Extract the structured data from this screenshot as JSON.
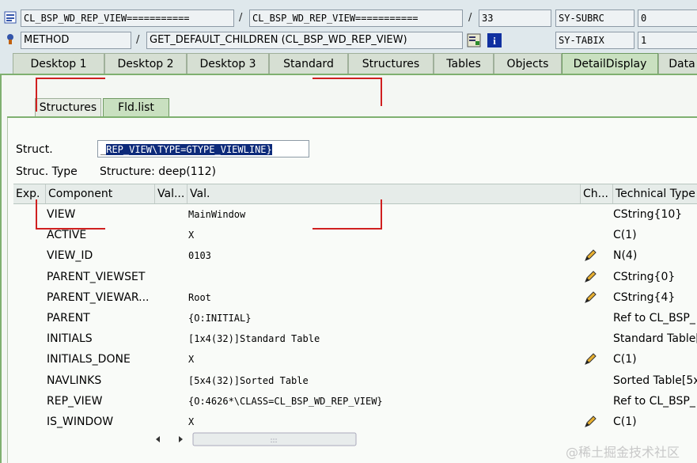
{
  "header": {
    "row1": {
      "field1": "CL_BSP_WD_REP_VIEW===========",
      "field2": "CL_BSP_WD_REP_VIEW===========",
      "line": "33",
      "sysvar_name": "SY-SUBRC",
      "sysvar_value": "0"
    },
    "row2": {
      "field1": "METHOD",
      "field2": "GET_DEFAULT_CHILDREN (CL_BSP_WD_REP_VIEW)",
      "sysvar_name": "SY-TABIX",
      "sysvar_value": "1"
    },
    "ellipsis": "_"
  },
  "tabs": [
    "Desktop 1",
    "Desktop 2",
    "Desktop 3",
    "Standard",
    "Structures",
    "Tables",
    "Objects",
    "DetailDisplay",
    "Data"
  ],
  "active_tab": "DetailDisplay",
  "subtabs": [
    "Structures",
    "Fld.list"
  ],
  "struct": {
    "label": "Struct.",
    "value": "REP_VIEW\\TYPE=GTYPE_VIEWLINE}",
    "value_prefix": "_",
    "type_label": "Struc. Type",
    "type_value": "Structure: deep(112)"
  },
  "table": {
    "headers": [
      "Exp.",
      "Component",
      "Val...",
      "Val.",
      "Ch...",
      "Technical Type"
    ],
    "rows": [
      {
        "component": "VIEW",
        "value": "MainWindow",
        "changeable": false,
        "type": "CString{10}"
      },
      {
        "component": "ACTIVE",
        "value": "X",
        "changeable": false,
        "type": "C(1)"
      },
      {
        "component": "VIEW_ID",
        "value": "0103",
        "changeable": true,
        "type": "N(4)"
      },
      {
        "component": "PARENT_VIEWSET",
        "value": "",
        "changeable": true,
        "type": "CString{0}"
      },
      {
        "component": "PARENT_VIEWAR...",
        "value": "Root",
        "changeable": true,
        "type": "CString{4}"
      },
      {
        "component": "PARENT",
        "value": "{O:INITIAL}",
        "changeable": false,
        "type": "Ref to CL_BSP_"
      },
      {
        "component": "INITIALS",
        "value": "[1x4(32)]Standard Table",
        "changeable": false,
        "type": "Standard Table["
      },
      {
        "component": "INITIALS_DONE",
        "value": "X",
        "changeable": true,
        "type": "C(1)"
      },
      {
        "component": "NAVLINKS",
        "value": "[5x4(32)]Sorted Table",
        "changeable": false,
        "type": "Sorted Table[5x"
      },
      {
        "component": "REP_VIEW",
        "value": "{O:4626*\\CLASS=CL_BSP_WD_REP_VIEW}",
        "changeable": false,
        "type": "Ref to CL_BSP_"
      },
      {
        "component": "IS_WINDOW",
        "value": "X",
        "changeable": true,
        "type": "C(1)"
      }
    ]
  },
  "icons": {
    "doc": "document-list-icon",
    "method": "method-icon",
    "edit": "edit-source-icon",
    "info": "info-icon",
    "pencil": "pencil-icon"
  },
  "watermark": "@稀土掘金技术社区",
  "colors": {
    "highlight": "#0d2a7a",
    "tab_active": "#c9e0c0",
    "accent_line": "#7fb070",
    "annotation_red": "#d02020"
  }
}
